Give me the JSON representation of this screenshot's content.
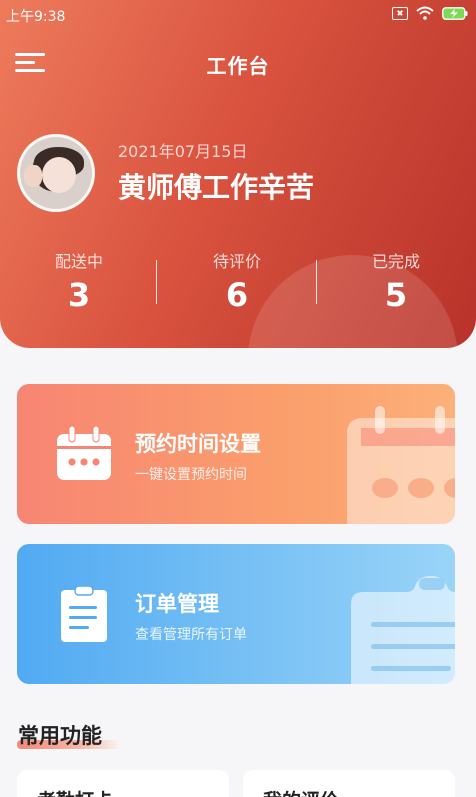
{
  "status_bar": {
    "time": "上午9:38"
  },
  "header": {
    "title": "工作台",
    "date": "2021年07月15日",
    "greeting": "黄师傅工作辛苦"
  },
  "stats": [
    {
      "label": "配送中",
      "value": "3"
    },
    {
      "label": "待评价",
      "value": "6"
    },
    {
      "label": "已完成",
      "value": "5"
    }
  ],
  "cards": {
    "appointment": {
      "title": "预约时间设置",
      "subtitle": "一键设置预约时间"
    },
    "orders": {
      "title": "订单管理",
      "subtitle": "查看管理所有订单"
    }
  },
  "section": {
    "title": "常用功能",
    "items": [
      {
        "label": "考勤打卡"
      },
      {
        "label": "我的评价"
      }
    ]
  },
  "colors": {
    "header_start": "#ee7b5c",
    "header_end": "#b8322a",
    "appointment_card": "#f78573",
    "orders_card": "#51aaf2",
    "accent_underline": "#f08a76"
  },
  "icons": {
    "menu": "menu-icon",
    "calendar": "calendar-icon",
    "clipboard": "clipboard-icon"
  }
}
